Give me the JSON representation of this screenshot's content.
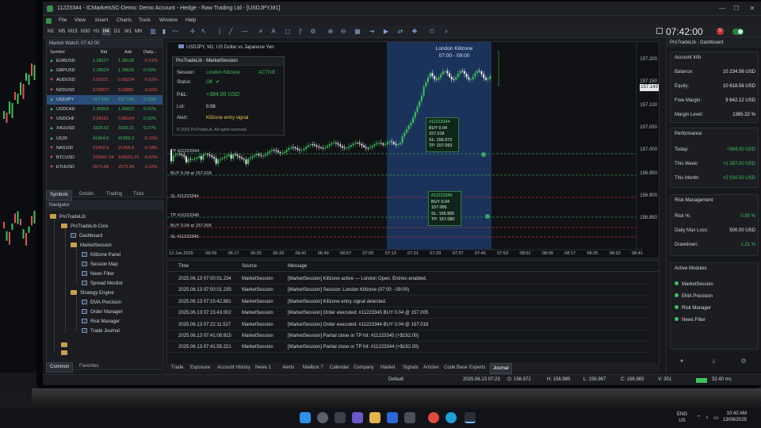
{
  "window": {
    "title": "11223344 - ICMarketsSC-Demo: Demo Account - Hedge - Raw Trading Ltd - [USDJPY,M1]"
  },
  "menu": [
    "File",
    "View",
    "Insert",
    "Charts",
    "Tools",
    "Window",
    "Help"
  ],
  "toolbar": {
    "timeframes": [
      "M1",
      "M5",
      "M15",
      "M30",
      "H1",
      "H4",
      "D1",
      "W1",
      "MN"
    ],
    "active_timeframe": "H4",
    "clock": "07:42:00",
    "alerts_badge": "5"
  },
  "market_watch": {
    "title": "Market Watch: 07:42:00",
    "columns": [
      "Symbol",
      "Bid",
      "Ask",
      "Daily..."
    ],
    "rows": [
      {
        "symbol": "EURUSD",
        "bid": "1.08127",
        "ask": "1.08128",
        "daily": "-0.01%",
        "dir": "up"
      },
      {
        "symbol": "GBPUSD",
        "bid": "1.28624",
        "ask": "1.28629",
        "daily": "0.03%",
        "dir": "up"
      },
      {
        "symbol": "AUDUSD",
        "bid": "0.65231",
        "ask": "0.65234",
        "daily": "-0.02%",
        "dir": "down"
      },
      {
        "symbol": "NZDUSD",
        "bid": "0.59877",
        "ask": "0.59881",
        "daily": "-0.02%",
        "dir": "down"
      },
      {
        "symbol": "USDJPY",
        "bid": "157.143",
        "ask": "157.145",
        "daily": "0.15%",
        "dir": "up",
        "selected": true
      },
      {
        "symbol": "USDCAD",
        "bid": "1.36818",
        "ask": "1.36823",
        "daily": "0.01%",
        "dir": "up"
      },
      {
        "symbol": "USDCHF",
        "bid": "0.88161",
        "ask": "0.88164",
        "daily": "0.02%",
        "dir": "down"
      },
      {
        "symbol": "XAUUSD",
        "bid": "3329.02",
        "ask": "3329.21",
        "daily": "0.27%",
        "dir": "up"
      },
      {
        "symbol": "US30",
        "bid": "41964.6",
        "ask": "41969.2",
        "daily": "-0.15%",
        "dir": "up"
      },
      {
        "symbol": "NAS100",
        "bid": "21452.8",
        "ask": "21455.6",
        "daily": "-0.18%",
        "dir": "down"
      },
      {
        "symbol": "BTCUSD",
        "bid": "105587.34",
        "ask": "105591.31",
        "daily": "-0.42%",
        "dir": "down"
      },
      {
        "symbol": "ETHUSD",
        "bid": "2571.68",
        "ask": "2573.34",
        "daily": "-1.02%",
        "dir": "down"
      }
    ],
    "tabs": [
      "Symbols",
      "Details",
      "Trading",
      "Ticks"
    ],
    "active_tab": "Symbols"
  },
  "navigator": {
    "title": "Navigator",
    "items": {
      "root": "ProTradeLib",
      "core": "ProTradeLib Core",
      "dashboard": "Dashboard",
      "marketsession": "MarketSession",
      "killzone": "Killzone Panel",
      "sessionmap": "Session Map",
      "newsfilter": "News Filter",
      "spread": "Spread Monitor",
      "strategy": "Strategy Engine",
      "ema": "EMA Precision",
      "order": "Order Manager",
      "risk": "Risk Manager",
      "journal": "Trade Journal"
    },
    "tabs": [
      "Common",
      "Favorites"
    ],
    "active_tab": "Common"
  },
  "chart": {
    "label": "USDJPY, M1: US Dollar vs Japanese Yen",
    "killzone_title": "London Killzone",
    "killzone_time": "07:00 - 09:00",
    "y_labels": [
      "157.200",
      "157.150",
      "157.100",
      "157.050",
      "157.000",
      "156.950",
      "156.900",
      "156.850"
    ],
    "current_price": "157.143",
    "x_labels": [
      "13 Jun 2025",
      "06:09",
      "06:17",
      "06:25",
      "06:33",
      "06:41",
      "06:49",
      "06:57",
      "07:05",
      "07:13",
      "07:21",
      "07:29",
      "07:37",
      "07:45",
      "07:53",
      "08:01",
      "08:09",
      "08:17",
      "08:25",
      "08:33",
      "08:41"
    ],
    "levels": {
      "tp1": "TP #11223344",
      "buy1": "BUY 0.04 at 157.018",
      "sl1": "SL #11223344",
      "tp2": "TP #11223345",
      "buy2": "BUY 0.04 at 157.005",
      "sl2": "SL #11223345"
    },
    "tooltip1": {
      "id": "#11223344",
      "l1": "BUY 0.04",
      "l2": "157.018",
      "l3": "SL: 156.973",
      "l4": "TP: 157.093"
    },
    "tooltip2": {
      "id": "#11223345",
      "l1": "BUY 0.04",
      "l2": "157.005",
      "l3": "SL: 156.965",
      "l4": "TP: 157.080"
    },
    "colors": {
      "bull": "#3ec25a",
      "bear": "#e9ecef",
      "killzone": "#1d3a66"
    }
  },
  "session_panel": {
    "title": "ProTradeLib - MarketSession",
    "session_label": "Session:",
    "session_value": "London Killzone",
    "session_state": "ACTIVE",
    "status_label": "Status:",
    "status_value": "OK",
    "pl_label": "P&L:",
    "pl_value": "+384.00 USD",
    "lot_label": "Lot:",
    "lot_value": "0.08",
    "alert_label": "Alert:",
    "alert_value": "Killzone entry signal",
    "footer": "© 2025 ProTradeLib. All rights reserved."
  },
  "journal": {
    "columns": [
      "Time",
      "Source",
      "Message"
    ],
    "rows": [
      {
        "time": "2025.06.13 07:00:01.234",
        "source": "MarketSession",
        "msg": "[MarketSession] Killzone active — London Open. Entries enabled."
      },
      {
        "time": "2025.06.13 07:00:01.235",
        "source": "MarketSession",
        "msg": "[MarketSession] Session: London Killzone (07:00 - 09:00)"
      },
      {
        "time": "2025.06.13 07:15:42.881",
        "source": "MarketSession",
        "msg": "[MarketSession] Killzone entry signal detected."
      },
      {
        "time": "2025.06.13 07:15:43.002",
        "source": "MarketSession",
        "msg": "[MarketSession] Order executed: #11223345 BUY 0.04 @ 157.005"
      },
      {
        "time": "2025.06.13 07:22:11.527",
        "source": "MarketSession",
        "msg": "[MarketSession] Order executed: #11223344 BUY 0.04 @ 157.018"
      },
      {
        "time": "2025.06.13 07:41:08.915",
        "source": "MarketSession",
        "msg": "[MarketSession] Partial close or TP hit: #11223345 (+$192.00)"
      },
      {
        "time": "2025.06.13 07:41:55.221",
        "source": "MarketSession",
        "msg": "[MarketSession] Partial close or TP hit: #11223344 (+$192.00)"
      }
    ],
    "tabs": [
      "Trade",
      "Exposure",
      "Account History",
      "News 1",
      "Alerts",
      "Mailbox 7",
      "Calendar",
      "Company",
      "Market",
      "Signals",
      "Articles",
      "Code Base",
      "Experts",
      "Journal"
    ],
    "active_tab": "Journal"
  },
  "status_bar": {
    "profile": "Default",
    "datetime": "2025.06.13 07:23",
    "open": "O: 156.972",
    "high": "H: 156.985",
    "low": "L: 156.967",
    "close": "C: 156.983",
    "volume": "V: 351",
    "speed": "32.40 ms"
  },
  "dashboard": {
    "title": "ProTradeLib - Dashboard",
    "account": {
      "title": "Account Info",
      "balance_label": "Balance:",
      "balance": "10 234.56 USD",
      "equity_label": "Equity:",
      "equity": "10 618.56 USD",
      "free_margin_label": "Free Margin:",
      "free_margin": "9 842.12 USD",
      "margin_level_label": "Margin Level:",
      "margin_level": "1365.32 %"
    },
    "performance": {
      "title": "Performance",
      "today_label": "Today:",
      "today": "+384.00 USD",
      "week_label": "This Week:",
      "week": "+1 287.00 USD",
      "month_label": "This Month:",
      "month": "+2 930.50 USD"
    },
    "risk": {
      "title": "Risk Management",
      "risk_label": "Risk %:",
      "risk": "0.80 %",
      "dml_label": "Daily Max Loss:",
      "dml": "500.00 USD",
      "dd_label": "Drawdown:",
      "dd": "1.21 %"
    },
    "modules": {
      "title": "Active Modules",
      "items": [
        "MarketSession",
        "EMA Precision",
        "Risk Manager",
        "News Filter"
      ]
    }
  },
  "taskbar": {
    "lang1": "ENG",
    "lang2": "US",
    "time": "10:42 AM",
    "date": "13/06/2025"
  }
}
